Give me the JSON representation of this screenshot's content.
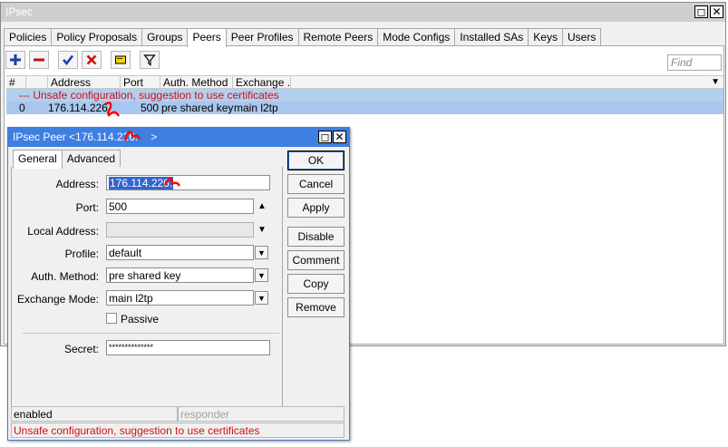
{
  "window": {
    "title": "IPsec",
    "restore_glyph": "◻",
    "close_glyph": "✕"
  },
  "tabs": [
    {
      "label": "Policies"
    },
    {
      "label": "Policy Proposals"
    },
    {
      "label": "Groups"
    },
    {
      "label": "Peers",
      "active": true
    },
    {
      "label": "Peer Profiles"
    },
    {
      "label": "Remote Peers"
    },
    {
      "label": "Mode Configs"
    },
    {
      "label": "Installed SAs"
    },
    {
      "label": "Keys"
    },
    {
      "label": "Users"
    }
  ],
  "toolbar": {
    "icons": [
      "add-icon",
      "remove-icon",
      "enable-icon",
      "disable-icon",
      "comment-icon",
      "filter-icon"
    ],
    "colors": {
      "add": "#1a3fb0",
      "remove": "#c01010",
      "enable": "#1a3fb0",
      "disable": "#d01010",
      "comment": "#e8c800"
    },
    "find_placeholder": "Find"
  },
  "table": {
    "columns": [
      "#",
      "Address",
      "Port",
      "Auth. Method",
      "Exchange ..."
    ],
    "comment_row": "--- Unsafe configuration, suggestion to use certificates",
    "rows": [
      {
        "num": "0",
        "address": "176.114.226.",
        "port": "500",
        "auth_method": "pre shared key",
        "exchange": "main l2tp"
      }
    ]
  },
  "dialog": {
    "title": "IPsec Peer <176.114.226.",
    "title_suffix": ">",
    "tabs": [
      "General",
      "Advanced"
    ],
    "fields": {
      "address_label": "Address:",
      "address_value": "176.114.226.",
      "port_label": "Port:",
      "port_value": "500",
      "local_address_label": "Local Address:",
      "local_address_value": "",
      "profile_label": "Profile:",
      "profile_value": "default",
      "auth_method_label": "Auth. Method:",
      "auth_method_value": "pre shared key",
      "exchange_mode_label": "Exchange Mode:",
      "exchange_mode_value": "main l2tp",
      "passive_label": "Passive",
      "secret_label": "Secret:",
      "secret_value": "**************"
    },
    "buttons": [
      "OK",
      "Cancel",
      "Apply",
      "Disable",
      "Comment",
      "Copy",
      "Remove"
    ],
    "status": {
      "state": "enabled",
      "role": "responder",
      "warning": "Unsafe configuration, suggestion to use certificates"
    },
    "colors": {
      "title_bar": "#3e7fe0",
      "warning": "#d01010",
      "selection": "#3366cc"
    }
  }
}
